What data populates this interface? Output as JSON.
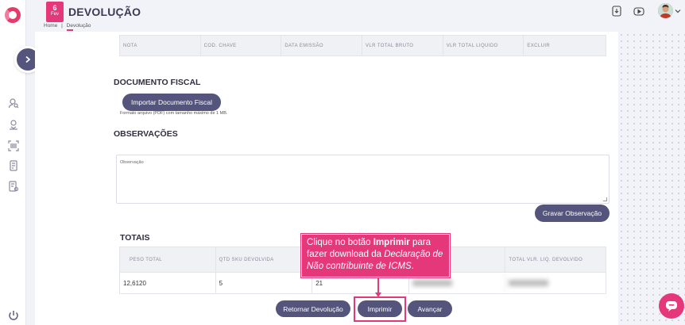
{
  "header": {
    "date_day": "6",
    "date_month": "Fev",
    "title": "DEVOLUÇÃO",
    "breadcrumb_home": "Home",
    "breadcrumb_sep": "|",
    "breadcrumb_current": "Devolução"
  },
  "invoice_table": {
    "columns": [
      "NOTA",
      "COD. CHAVE",
      "DATA EMISSÃO",
      "VLR TOTAL BRUTO",
      "VLR TOTAL LIQUIDO",
      "EXCLUIR"
    ]
  },
  "documento_fiscal": {
    "title": "DOCUMENTO FISCAL",
    "import_button": "Importar Documento Fiscal",
    "hint": "Formato arquivo (PDF) com tamanho máximo de 1 MB."
  },
  "observacoes": {
    "title": "OBSERVAÇÕES",
    "placeholder": "Observação",
    "save_button": "Gravar Observação"
  },
  "totais": {
    "title": "TOTAIS",
    "columns": [
      "PESO TOTAL",
      "QTD SKU DEVOLVIDA",
      "",
      "",
      "TOTAL VLR. LIQ. DEVOLVIDO"
    ],
    "row": [
      "12,6120",
      "5",
      "21",
      "",
      ""
    ]
  },
  "actions": {
    "back": "Retornar Devolução",
    "print": "Imprimir",
    "next": "Avançar"
  },
  "callout": {
    "part1": "Clique no botão ",
    "bold": "Imprimir",
    "part2": " para fazer download da ",
    "italic": "Declaração de Não contribuinte de ICMS",
    "part3": "."
  },
  "colors": {
    "brand_pink": "#e4387a",
    "button_purple": "#54547c"
  }
}
